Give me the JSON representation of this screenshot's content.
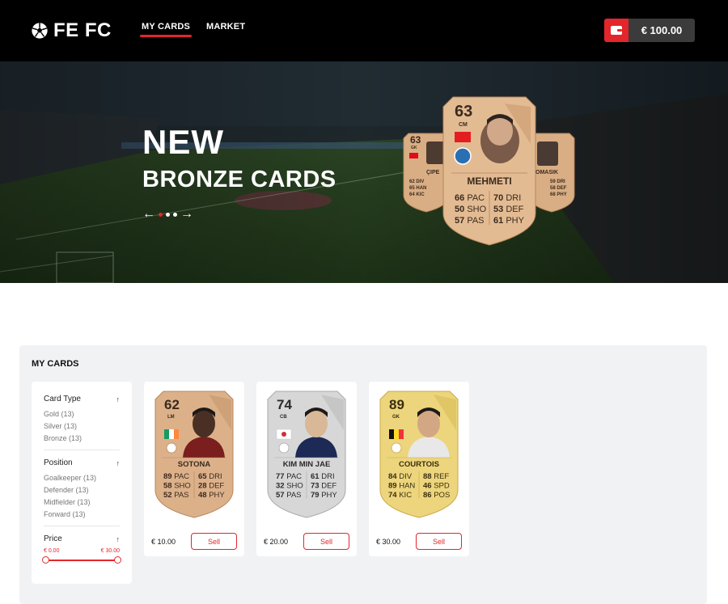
{
  "header": {
    "logo_text": "FE FC",
    "nav": [
      {
        "label": "MY CARDS",
        "active": true
      },
      {
        "label": "MARKET",
        "active": false
      }
    ],
    "wallet_amount": "€ 100.00",
    "accent_color": "#e3262b"
  },
  "hero": {
    "title": "NEW",
    "subtitle": "BRONZE CARDS",
    "carousel_dots": 3,
    "featured": [
      {
        "rating": "63",
        "position": "GK",
        "name": "ÇIPE",
        "stats": [
          [
            "62",
            "DIV"
          ],
          [
            "65",
            "HAN"
          ],
          [
            "64",
            "KIC"
          ]
        ]
      },
      {
        "rating": "63",
        "position": "CM",
        "name": "MEHMETI",
        "stats": [
          [
            "66",
            "PAC"
          ],
          [
            "50",
            "SHO"
          ],
          [
            "57",
            "PAS"
          ],
          [
            "70",
            "DRI"
          ],
          [
            "53",
            "DEF"
          ],
          [
            "61",
            "PHY"
          ]
        ]
      },
      {
        "rating": "",
        "position": "",
        "name": "OMASIK",
        "stats": [
          [
            "59",
            "DRI"
          ],
          [
            "58",
            "DEF"
          ],
          [
            "68",
            "PHY"
          ]
        ]
      }
    ]
  },
  "my_cards": {
    "title": "MY CARDS",
    "filters": [
      {
        "label": "Card Type",
        "options": [
          "Gold (13)",
          "Silver (13)",
          "Bronze (13)"
        ]
      },
      {
        "label": "Position",
        "options": [
          "Goalkeeper (13)",
          "Defender (13)",
          "Midfielder (13)",
          "Forward (13)"
        ]
      },
      {
        "label": "Price",
        "min_label": "€ 0.00",
        "max_label": "€ 30.00"
      }
    ],
    "sell_label": "Sell",
    "cards": [
      {
        "tier": "bronze",
        "rating": "62",
        "position": "LM",
        "name": "SOTONA",
        "price": "€ 10.00",
        "left": [
          [
            "89",
            "PAC"
          ],
          [
            "58",
            "SHO"
          ],
          [
            "52",
            "PAS"
          ]
        ],
        "right": [
          [
            "65",
            "DRI"
          ],
          [
            "28",
            "DEF"
          ],
          [
            "48",
            "PHY"
          ]
        ]
      },
      {
        "tier": "silver",
        "rating": "74",
        "position": "CB",
        "name": "KIM MIN JAE",
        "price": "€ 20.00",
        "left": [
          [
            "77",
            "PAC"
          ],
          [
            "32",
            "SHO"
          ],
          [
            "57",
            "PAS"
          ]
        ],
        "right": [
          [
            "61",
            "DRI"
          ],
          [
            "73",
            "DEF"
          ],
          [
            "79",
            "PHY"
          ]
        ]
      },
      {
        "tier": "gold",
        "rating": "89",
        "position": "GK",
        "name": "COURTOIS",
        "price": "€ 30.00",
        "left": [
          [
            "84",
            "DIV"
          ],
          [
            "89",
            "HAN"
          ],
          [
            "74",
            "KIC"
          ]
        ],
        "right": [
          [
            "88",
            "REF"
          ],
          [
            "46",
            "SPD"
          ],
          [
            "86",
            "POS"
          ]
        ]
      }
    ]
  }
}
